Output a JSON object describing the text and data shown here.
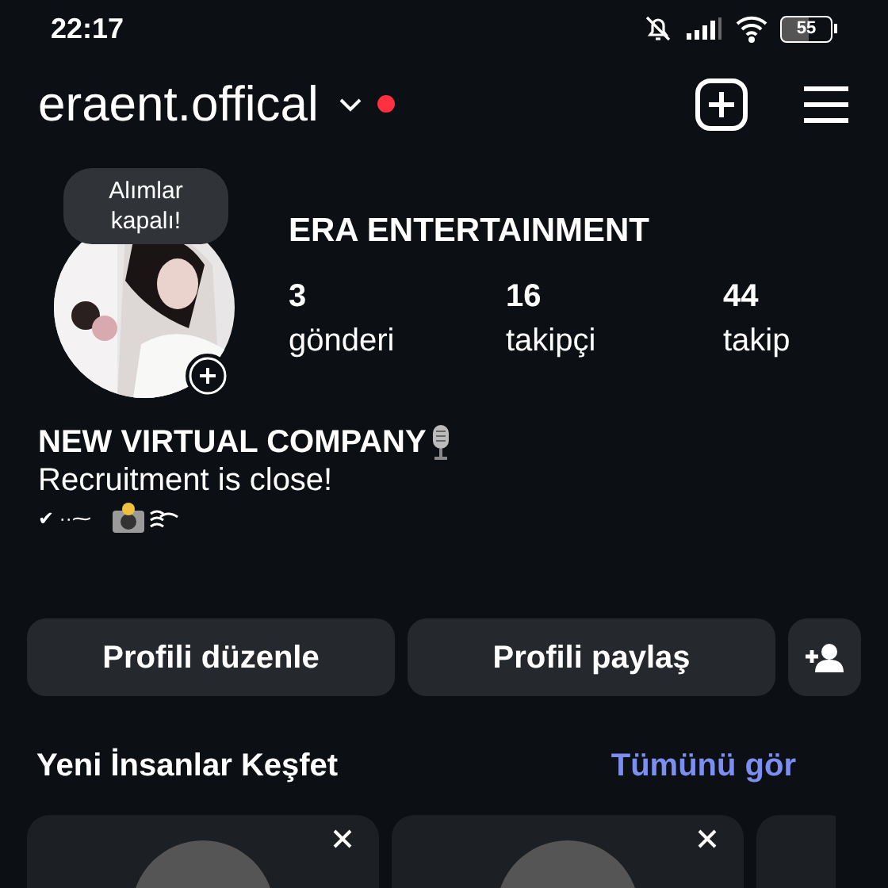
{
  "status_bar": {
    "time": "22:17",
    "battery": "55"
  },
  "header": {
    "username": "eraent.offical",
    "notification_dot": true
  },
  "profile": {
    "note": "Alımlar kapalı!",
    "name": "ERA ENTERTAINMENT",
    "stats": [
      {
        "value": "3",
        "label": "gönderi"
      },
      {
        "value": "16",
        "label": "takipçi"
      },
      {
        "value": "44",
        "label": "takip"
      }
    ],
    "bio_title": "NEW VIRTUAL COMPANY",
    "bio_text": "Recruitment is close!",
    "bio_deco": "✔ ··⁓"
  },
  "buttons": [
    "Profili düzenle",
    "Profili paylaş"
  ],
  "discover": {
    "title": "Yeni İnsanlar Keşfet",
    "link": "Tümünü gör",
    "cards": [
      {
        "kind": "person"
      },
      {
        "kind": "person"
      },
      {
        "kind": "partial"
      }
    ]
  }
}
